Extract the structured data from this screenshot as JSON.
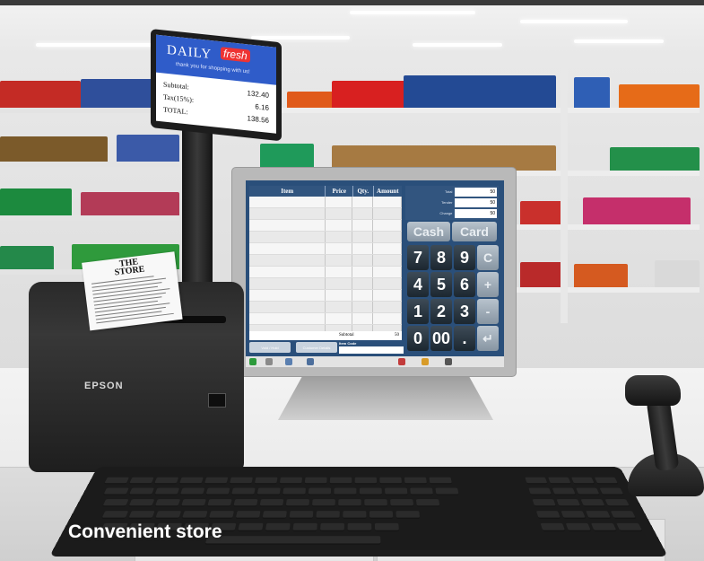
{
  "caption": "Convenient store",
  "customer_display": {
    "brand_word1": "DAILY",
    "brand_word2": "fresh",
    "thanks": "thank you for shopping with us!",
    "rows": [
      {
        "label": "Subtotal:",
        "value": "132.40"
      },
      {
        "label": "Tax(15%):",
        "value": "6.16"
      },
      {
        "label": "TOTAL:",
        "value": "138.56"
      }
    ]
  },
  "pos_screen": {
    "columns": [
      "Item",
      "Price",
      "Qty.",
      "Amount"
    ],
    "subtotal_label": "Subtotal",
    "subtotal_value": "50",
    "summary": [
      {
        "label": "Total",
        "value": "50"
      },
      {
        "label": "Tender",
        "value": "50"
      },
      {
        "label": "Change",
        "value": "50"
      }
    ],
    "cash_label": "Cash",
    "card_label": "Card",
    "keys": [
      "7",
      "8",
      "9",
      "C",
      "4",
      "5",
      "6",
      "+",
      "1",
      "2",
      "3",
      "-",
      "0",
      "00",
      ".",
      "↵"
    ],
    "bottom_buttons": [
      "Void / Hold",
      "Customer Details"
    ],
    "item_code_label": "Item Code"
  },
  "printer": {
    "brand": "EPSON",
    "receipt_title_line1": "THE",
    "receipt_title_line2": "STORE"
  }
}
